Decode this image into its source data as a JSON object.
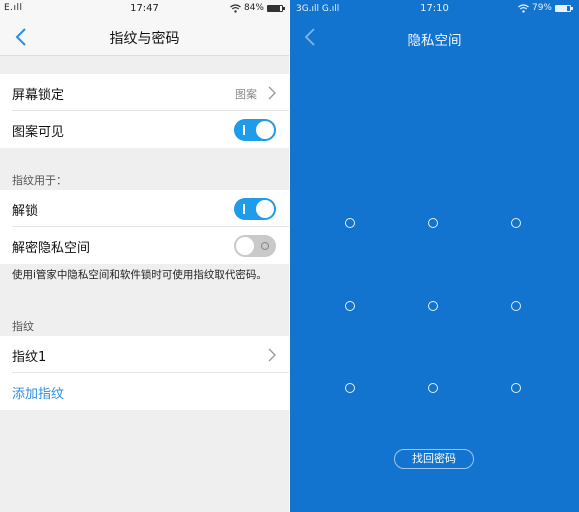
{
  "left": {
    "status_bar": {
      "signal": "E.ıll",
      "time": "17:47",
      "battery": "84%",
      "battery_level": 0.84
    },
    "nav": {
      "title": "指纹与密码"
    },
    "rows": {
      "screen_lock": {
        "label": "屏幕锁定",
        "value": "图案"
      },
      "pattern_visible": {
        "label": "图案可见",
        "toggle": "on"
      },
      "unlock": {
        "label": "解锁",
        "toggle": "on"
      },
      "private_space": {
        "label": "解密隐私空间",
        "toggle": "off"
      },
      "fingerprint1": {
        "label": "指纹1"
      },
      "add_fingerprint": {
        "label": "添加指纹"
      }
    },
    "sections": {
      "fingerprint_for": "指纹用于：",
      "fingerprint": "指纹"
    },
    "note": "使用i管家中隐私空间和软件锁时可使用指纹取代密码。"
  },
  "right": {
    "status_bar": {
      "signal": "3G.ıll G.ıll",
      "time": "17:10",
      "battery": "79%",
      "battery_level": 0.79
    },
    "title": "隐私空间",
    "pattern_grid": {
      "rows": 3,
      "cols": 3
    },
    "recover_button": "找回密码"
  },
  "colors": {
    "accent": "#1e9be9",
    "right_background": "#1274cf",
    "link": "#2b8fe6"
  }
}
